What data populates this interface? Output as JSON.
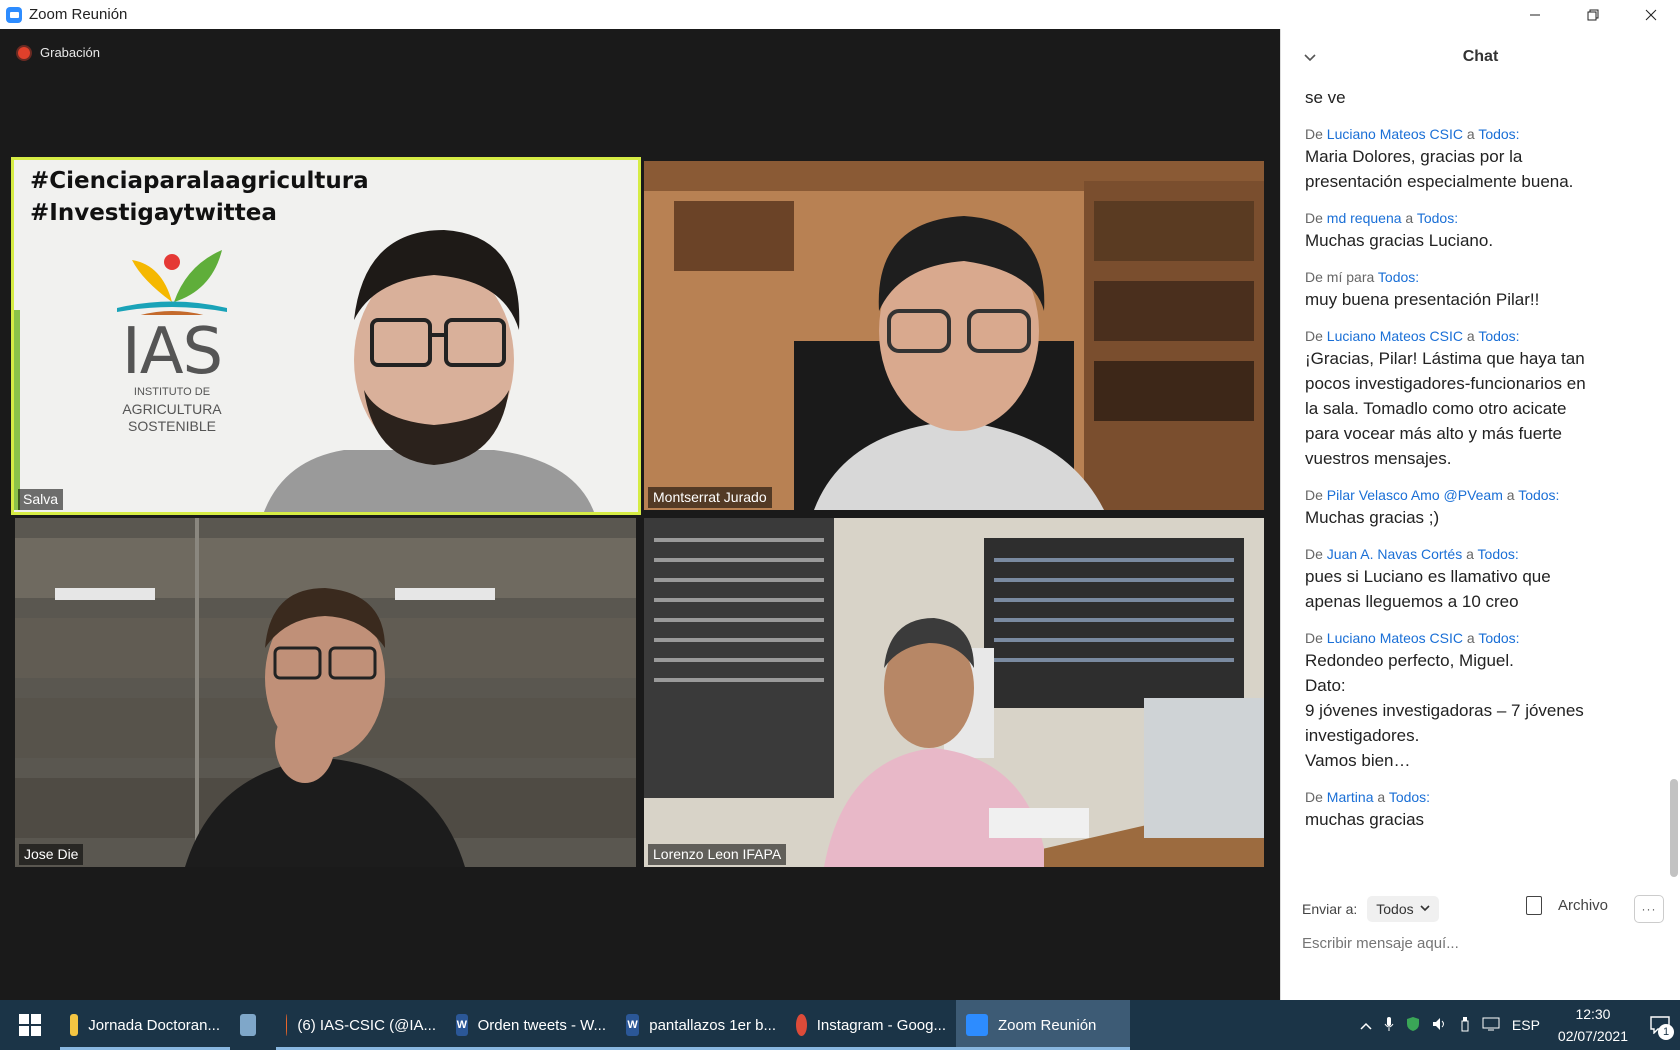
{
  "window": {
    "title": "Zoom Reunión",
    "controls": [
      "minimize",
      "restore",
      "close"
    ]
  },
  "recording": {
    "label": "Grabación"
  },
  "participants": [
    {
      "name": "Salva",
      "active_speaker": true,
      "overlay": {
        "hashtags": [
          "#Cienciaparalaagricultura",
          "#Investigaytwittea"
        ],
        "logo_text": "IAS",
        "logo_sub": [
          "INSTITUTO DE",
          "AGRICULTURA",
          "SOSTENIBLE"
        ]
      }
    },
    {
      "name": "Montserrat Jurado"
    },
    {
      "name": "Jose Die"
    },
    {
      "name": "Lorenzo Leon IFAPA"
    }
  ],
  "chat": {
    "title": "Chat",
    "prefix_from": "De",
    "connector_to": "a",
    "connector_for": "para",
    "messages": [
      {
        "from": "",
        "to": "",
        "text": [
          "se ve"
        ]
      },
      {
        "from": "Luciano Mateos CSIC",
        "to": "Todos:",
        "text": [
          "Maria Dolores, gracias por la",
          "presentación especialmente buena."
        ]
      },
      {
        "from": "md requena",
        "to": "Todos:",
        "text": [
          "Muchas gracias Luciano."
        ]
      },
      {
        "from": "mí",
        "to": "Todos:",
        "self": true,
        "text": [
          "muy buena presentación Pilar!!"
        ]
      },
      {
        "from": "Luciano Mateos CSIC",
        "to": "Todos:",
        "text": [
          "¡Gracias, Pilar! Lástima que haya tan",
          "pocos investigadores-funcionarios en",
          "la sala. Tomadlo como otro acicate",
          "para vocear más alto y más fuerte",
          "vuestros mensajes."
        ]
      },
      {
        "from": "Pilar Velasco Amo @PVeam",
        "to": "Todos:",
        "text": [
          "Muchas gracias ;)"
        ]
      },
      {
        "from": "Juan A. Navas Cortés",
        "to": "Todos:",
        "text": [
          "pues si Luciano es llamativo que",
          "apenas lleguemos a 10 creo"
        ]
      },
      {
        "from": "Luciano Mateos CSIC",
        "to": "Todos:",
        "text": [
          "Redondeo perfecto, Miguel.",
          "Dato:",
          "9 jóvenes investigadoras – 7 jóvenes",
          "investigadores.",
          "Vamos bien…"
        ]
      },
      {
        "from": "Martina",
        "to": "Todos:",
        "text": [
          "muchas gracias"
        ]
      }
    ],
    "send_to_label": "Enviar a:",
    "send_to_value": "Todos",
    "file_label": "Archivo",
    "more_label": "···",
    "placeholder": "Escribir mensaje aquí..."
  },
  "taskbar": {
    "items": [
      {
        "label": "Jornada Doctoran...",
        "icon": "folder-icon",
        "color": "#f4c542"
      },
      {
        "label": "",
        "icon": "laptop-icon",
        "color": "#7fa7c9"
      },
      {
        "label": "(6) IAS-CSIC (@IA...",
        "icon": "firefox-icon",
        "color": "#e8662b"
      },
      {
        "label": "Orden tweets - W...",
        "icon": "word-icon",
        "color": "#2b5797"
      },
      {
        "label": "pantallazos 1er b...",
        "icon": "word-icon",
        "color": "#2b5797"
      },
      {
        "label": "Instagram - Goog...",
        "icon": "chrome-icon",
        "color": "#dd4b39"
      },
      {
        "label": "Zoom Reunión",
        "icon": "zoom-icon",
        "color": "#2d8cff",
        "active": true
      }
    ],
    "language": "ESP",
    "time": "12:30",
    "date": "02/07/2021",
    "notifications": "1"
  }
}
